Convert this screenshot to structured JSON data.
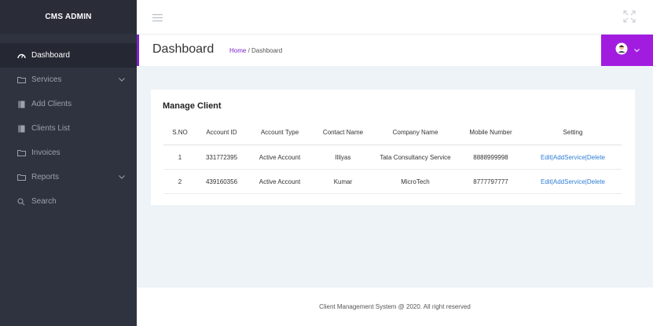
{
  "sidebar": {
    "brand": "CMS ADMIN",
    "items": [
      {
        "label": "Dashboard",
        "icon": "dashboard-icon"
      },
      {
        "label": "Services",
        "icon": "folder-icon"
      },
      {
        "label": "Add Clients",
        "icon": "book-icon"
      },
      {
        "label": "Clients List",
        "icon": "book-icon"
      },
      {
        "label": "Invoices",
        "icon": "folder-icon"
      },
      {
        "label": "Reports",
        "icon": "folder-icon"
      },
      {
        "label": "Search",
        "icon": "search-icon"
      }
    ]
  },
  "header": {
    "title": "Dashboard",
    "breadcrumb_home": "Home",
    "breadcrumb_sep": " / ",
    "breadcrumb_current": "Dashboard"
  },
  "card": {
    "title": "Manage Client",
    "columns": [
      "S.NO",
      "Account ID",
      "Account Type",
      "Contact Name",
      "Company Name",
      "Mobile Number",
      "Setting"
    ],
    "rows": [
      {
        "sno": "1",
        "account_id": "331772395",
        "account_type": "Active Account",
        "contact": "Illiyas",
        "company": "Tata Consultancy Service",
        "mobile": "8888999998"
      },
      {
        "sno": "2",
        "account_id": "439160356",
        "account_type": "Active Account",
        "contact": "Kumar",
        "company": "MicroTech",
        "mobile": "8777797777"
      }
    ],
    "actions": {
      "edit": "Edit",
      "add_service": "AddService",
      "delete": "Delete",
      "sep": "|"
    }
  },
  "footer": {
    "text": "Client Management System @ 2020. All right reserved"
  },
  "colors": {
    "sidebar_bg": "#2f333f",
    "accent_purple": "#a21ce0",
    "link_blue": "#2f7ed8",
    "content_bg": "#eef3f7"
  }
}
